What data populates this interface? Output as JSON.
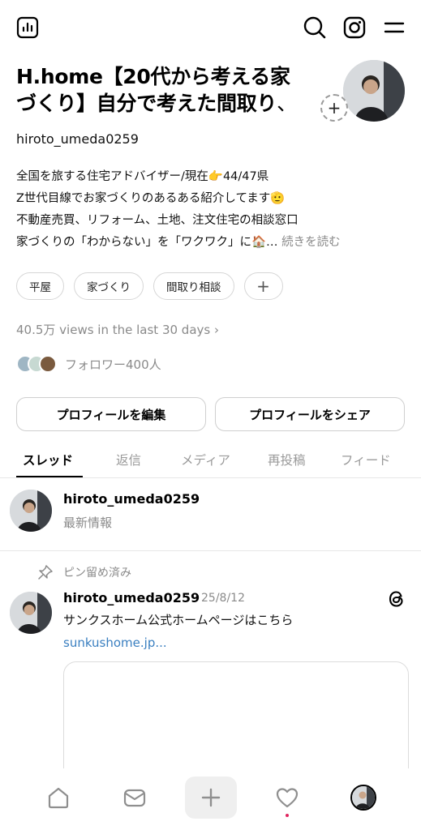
{
  "topbar": {
    "icons": [
      "insights-icon",
      "search-icon",
      "instagram-icon",
      "menu-icon"
    ]
  },
  "profile": {
    "name_line1": "H.home【20代から考える家",
    "name_line2": "づくり】自分で考えた間取り",
    "name_tail": "、",
    "username": "hiroto_umeda0259",
    "bio": [
      "全国を旅する住宅アドバイザー/現在👉44/47県",
      "Z世代目線でお家づくりのあるある紹介してます🫡",
      "不動産売買、リフォーム、土地、注文住宅の相談窓口",
      "家づくりの「わからない」を「ワクワク」に🏠…"
    ],
    "bio_more": "続きを読む",
    "tags": [
      "平屋",
      "家づくり",
      "間取り相談"
    ],
    "tag_add": "+",
    "views": "40.5万 views in the last 30 days ›",
    "followers": "フォロワー400人",
    "edit_button": "プロフィールを編集",
    "share_button": "プロフィールをシェア"
  },
  "tabs": [
    "スレッド",
    "返信",
    "メディア",
    "再投稿",
    "フィード"
  ],
  "latest": {
    "username": "hiroto_umeda0259",
    "subtitle": "最新情報"
  },
  "pinned_label": "ピン留め済み",
  "post": {
    "username": "hiroto_umeda0259",
    "date": "25/8/12",
    "text": "サンクスホーム公式ホームページはこちら",
    "link": "sunkushome.jp..."
  },
  "colors": {
    "link": "#3a7fc0",
    "muted": "#8a8a8a",
    "notification_dot": "#e0245e"
  },
  "bottom_nav": [
    "home-icon",
    "inbox-icon",
    "create-icon",
    "heart-icon",
    "profile-avatar"
  ]
}
